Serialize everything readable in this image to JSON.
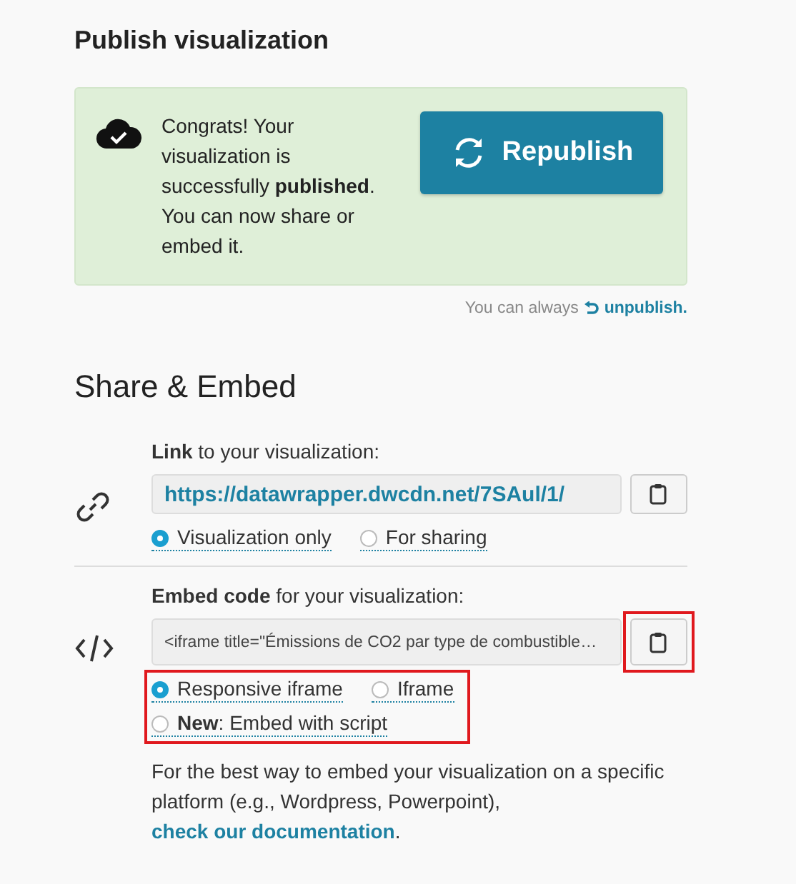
{
  "publish": {
    "title": "Publish visualization",
    "message": "Congrats! Your visualization is successfully **published**. You can now share or embed it.",
    "button": "Republish",
    "unpublish_prefix": "You can always",
    "unpublish_link": "unpublish."
  },
  "share": {
    "title": "Share & Embed",
    "sections": [
      {
        "kind": "link",
        "label": "**Link** to your visualization:",
        "value": "https://datawrapper.dwcdn.net/7SAul/1/",
        "copy_highlighted": false,
        "options_highlighted": false,
        "options": [
          {
            "label": "Visualization only",
            "selected": true
          },
          {
            "label": "For sharing",
            "selected": false
          }
        ]
      },
      {
        "kind": "embed",
        "label": "**Embed code** for your visualization:",
        "value": "<iframe title=\"Émissions de CO2 par type de combustible…",
        "copy_highlighted": true,
        "options_highlighted": true,
        "options": [
          {
            "label": "Responsive iframe",
            "selected": true
          },
          {
            "label": "Iframe",
            "selected": false
          },
          {
            "label": "**New**: Embed with script",
            "selected": false
          }
        ]
      }
    ],
    "help_text": "For the best way to embed your visualization on a specific platform (e.g., Wordpress, Powerpoint),",
    "help_link": "check our documentation",
    "help_end": "."
  }
}
